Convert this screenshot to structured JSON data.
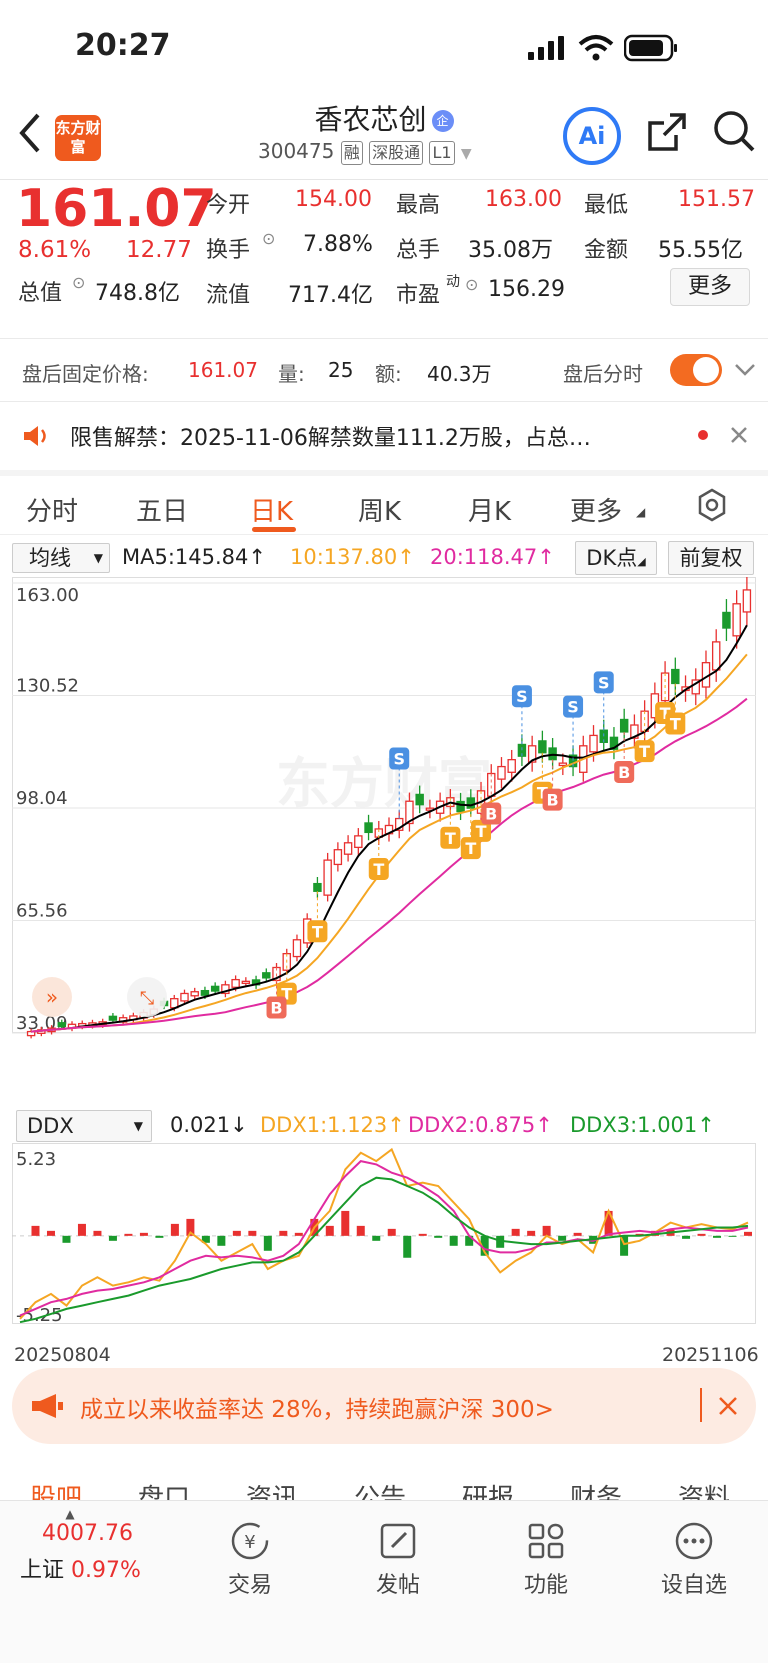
{
  "status": {
    "time": "20:27"
  },
  "header": {
    "back_icon": "chevron-left-icon",
    "logo_text": "东方财富",
    "title": "香农芯创",
    "badge": "企",
    "code": "300475",
    "tags": [
      "融",
      "深股通",
      "L1"
    ],
    "ai_label": "Ai"
  },
  "quote": {
    "price": "161.07",
    "change_pct": "8.61%",
    "change": "12.77",
    "open_label": "今开",
    "open": "154.00",
    "high_label": "最高",
    "high": "163.00",
    "low_label": "最低",
    "low": "151.57",
    "turnover_label": "换手",
    "turnover": "7.88%",
    "volume_label": "总手",
    "volume": "35.08万",
    "amount_label": "金额",
    "amount": "55.55亿",
    "mktcap_label": "总值",
    "mktcap": "748.8亿",
    "float_label": "流值",
    "float_cap": "717.4亿",
    "pe_label": "市盈",
    "pe_sup": "动",
    "pe": "156.29",
    "more_label": "更多"
  },
  "after_hours": {
    "price_label": "盘后固定价格:",
    "price": "161.07",
    "vol_label": "量:",
    "vol": "25",
    "amt_label": "额:",
    "amt": "40.3万",
    "timeshare_label": "盘后分时",
    "toggle_on": true
  },
  "notice": {
    "text": "限售解禁：2025-11-06解禁数量111.2万股，占总…"
  },
  "chart_tabs": [
    "分时",
    "五日",
    "日K",
    "周K",
    "月K",
    "更多"
  ],
  "active_tab": "日K",
  "ma_legend": {
    "select": "均线",
    "ma5": "MA5:145.84↑",
    "ma10": "10:137.80↑",
    "ma20": "20:118.47↑",
    "dk": "DK点",
    "adjust": "前复权",
    "watermark": "东方财富"
  },
  "chart_data": [
    {
      "type": "candlestick",
      "title": "日K",
      "y_ticks": [
        "163.00",
        "130.52",
        "98.04",
        "65.56",
        "33.09"
      ],
      "ylim": [
        33.09,
        163.0
      ],
      "x_range": [
        "20250804",
        "20251106"
      ],
      "series": [
        {
          "name": "MA5",
          "color": "#000000",
          "last": 145.84
        },
        {
          "name": "10",
          "color": "#f5a623",
          "last": 137.8
        },
        {
          "name": "20",
          "color": "#e02ba0",
          "last": 118.47
        }
      ],
      "closes": [
        33.5,
        34,
        34.5,
        35,
        35.6,
        35.8,
        36,
        36.3,
        36.8,
        37.5,
        38,
        39,
        40,
        41,
        43,
        44.5,
        45,
        44,
        45.2,
        47,
        48.5,
        48,
        47,
        49,
        52,
        56,
        60,
        66,
        74,
        83,
        86,
        88,
        90,
        91,
        92,
        93,
        95,
        100,
        99,
        98,
        100,
        101,
        97,
        98,
        103,
        108,
        110,
        112,
        113,
        116,
        114,
        112,
        111,
        110,
        116,
        119,
        117,
        115,
        120,
        122,
        126,
        131,
        137,
        134,
        133,
        135,
        140,
        146,
        150,
        157,
        161
      ],
      "signals": [
        {
          "label": "T",
          "index": 25
        },
        {
          "label": "B",
          "index": 24
        },
        {
          "label": "T",
          "index": 28
        },
        {
          "label": "T",
          "index": 34
        },
        {
          "label": "S",
          "index": 36
        },
        {
          "label": "T",
          "index": 41
        },
        {
          "label": "T",
          "index": 43
        },
        {
          "label": "T",
          "index": 44
        },
        {
          "label": "B",
          "index": 45
        },
        {
          "label": "S",
          "index": 48
        },
        {
          "label": "T",
          "index": 50
        },
        {
          "label": "B",
          "index": 51
        },
        {
          "label": "S",
          "index": 53
        },
        {
          "label": "S",
          "index": 56
        },
        {
          "label": "B",
          "index": 58
        },
        {
          "label": "T",
          "index": 60
        },
        {
          "label": "T",
          "index": 62
        },
        {
          "label": "T",
          "index": 63
        }
      ]
    },
    {
      "type": "line",
      "title": "DDX",
      "y_ticks": [
        "5.23",
        "-5.25"
      ],
      "ylim": [
        -5.25,
        5.23
      ],
      "x_labels": [
        "20250804",
        "20251106"
      ],
      "series": [
        {
          "name": "DDX1",
          "color": "#f5a623",
          "values": [
            -5,
            -4,
            -3.5,
            -4.2,
            -3,
            -2.5,
            -3,
            -2.8,
            -2.5,
            -2.7,
            -1.5,
            0.2,
            -0.5,
            -1.5,
            -1,
            -0.5,
            -2,
            -1.5,
            -1.2,
            0.5,
            1.5,
            4,
            5,
            4.5,
            5.2,
            3,
            3.2,
            3,
            2,
            1,
            -1,
            -2.2,
            -1.5,
            -1,
            0,
            -0.5,
            -0.2,
            -1,
            1.5,
            -0.5,
            -0.3,
            0.2,
            0.8,
            0.5,
            0.7,
            0.5,
            0.4,
            0.8
          ]
        },
        {
          "name": "DDX2",
          "color": "#e02ba0",
          "values": [
            -4.8,
            -4.4,
            -4,
            -3.8,
            -3.5,
            -3.3,
            -3.2,
            -3,
            -2.8,
            -2.5,
            -2,
            -1.5,
            -1.2,
            -1.3,
            -1.2,
            -1.3,
            -1.5,
            -1.2,
            -0.5,
            1,
            2.5,
            3.6,
            4.5,
            4.3,
            3.8,
            3.5,
            3,
            2.4,
            1.5,
            0,
            -0.8,
            -1,
            -1,
            -0.8,
            -0.4,
            -0.4,
            -0.2,
            -0.3,
            0.1,
            0.2,
            0.3,
            0.2,
            0.4,
            0.5,
            0.4,
            0.3,
            0.3,
            0.5
          ]
        },
        {
          "name": "DDX3",
          "color": "#1a9a2c",
          "values": [
            -5.2,
            -5,
            -4.7,
            -4.4,
            -4.2,
            -4,
            -3.8,
            -3.6,
            -3.3,
            -3,
            -2.8,
            -2.6,
            -2.3,
            -2,
            -1.8,
            -1.6,
            -1.6,
            -1.5,
            -1,
            0,
            1,
            2,
            3,
            3.5,
            3.4,
            3,
            2.6,
            2,
            1.2,
            0.5,
            0,
            -0.3,
            -0.4,
            -0.5,
            -0.5,
            -0.4,
            -0.3,
            -0.2,
            -0.1,
            0,
            0,
            0.1,
            0.2,
            0.3,
            0.4,
            0.5,
            0.5,
            0.6
          ]
        }
      ]
    }
  ],
  "ddx_legend": {
    "select": "DDX",
    "value": "0.021↓",
    "ddx1": "DDX1:1.123↑",
    "ddx2": "DDX2:0.875↑",
    "ddx3": "DDX3:1.001↑"
  },
  "banner": {
    "text": "成立以来收益率达 28%，持续跑赢沪深 300>"
  },
  "bottom_tabs": [
    "股吧",
    "盘口",
    "资讯",
    "公告",
    "研报",
    "财务",
    "资料"
  ],
  "bottom_nav": {
    "index_value": "4007.76",
    "index_name": "上证",
    "index_change": "0.97%",
    "items": [
      "交易",
      "发帖",
      "功能",
      "设自选"
    ]
  },
  "colors": {
    "up": "#e8302f",
    "down": "#1a9a2c",
    "accent": "#ef5a1e",
    "blue": "#2f7af6"
  }
}
